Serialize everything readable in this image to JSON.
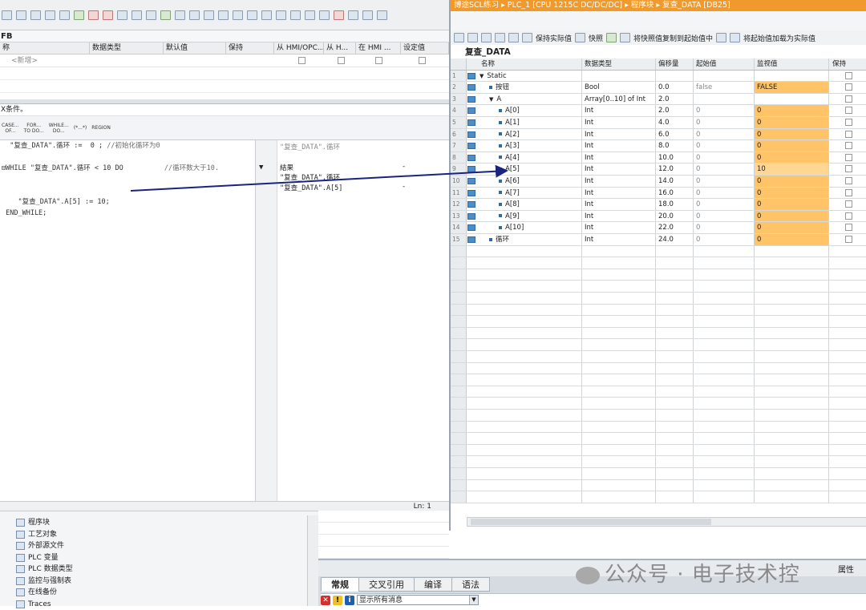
{
  "editor": {
    "block_label": "FB",
    "interface_headers": [
      "称",
      "数据类型",
      "默认值",
      "保持",
      "从 HMI/OPC...",
      "从 H...",
      "在 HMI ...",
      "设定值"
    ],
    "interface_new_row": "<新增>",
    "condition_label": "X条件。",
    "instructions": [
      {
        "line1": "CASE...",
        "line2": "OF..."
      },
      {
        "line1": "FOR...",
        "line2": "TO DO..."
      },
      {
        "line1": "WHILE...",
        "line2": "DO..."
      },
      {
        "line1": "(*...*)",
        "line2": ""
      },
      {
        "line1": "REGION",
        "line2": ""
      }
    ],
    "code_lines": [
      {
        "code": "  \"复查_DATA\".循环 :=  0 ;",
        "comment": " //初始化循环为0"
      },
      {
        "code": "",
        "comment": ""
      },
      {
        "code": "⊟WHILE \"复查_DATA\".循环 < 10 DO",
        "comment": "          //循环数大于10."
      },
      {
        "code": "",
        "comment": ""
      },
      {
        "code": "",
        "comment": ""
      },
      {
        "code": "    \"复查_DATA\".A[5] := 10;",
        "comment": ""
      },
      {
        "code": " END_WHILE;",
        "comment": ""
      }
    ],
    "watch": {
      "line1": "\"复查_DATA\".循环",
      "result_label": "結果",
      "line3": "\"复查_DATA\".循环",
      "line4": "\"复查_DATA\".A[5]",
      "dash": "-"
    },
    "status": "Ln: 1"
  },
  "project_tree": {
    "items": [
      {
        "label": "程序块",
        "icon": "program-block-icon"
      },
      {
        "label": "工艺对象",
        "icon": "technology-object-icon"
      },
      {
        "label": "外部源文件",
        "icon": "external-source-icon"
      },
      {
        "label": "PLC 变量",
        "icon": "plc-tags-icon"
      },
      {
        "label": "PLC 数据类型",
        "icon": "plc-data-type-icon"
      },
      {
        "label": "监控与强制表",
        "icon": "watch-table-icon"
      },
      {
        "label": "在线备份",
        "icon": "online-backup-icon"
      },
      {
        "label": "Traces",
        "icon": "traces-icon"
      }
    ]
  },
  "inspector": {
    "tabs": [
      "常规",
      "交叉引用",
      "编译",
      "语法"
    ],
    "message_filter": "显示所有消息",
    "properties_label": "属性"
  },
  "watermark": "公众号 · 电子技术控",
  "db_window": {
    "breadcrumb": "博途SCL练习 ▸ PLC_1 [CPU 1215C DC/DC/DC] ▸ 程序块 ▸ 复查_DATA [DB25]",
    "toolbar": {
      "keep_actual": "保持实际值",
      "snapshot": "快照",
      "copy_snapshot": "将快照值复制到起始值中",
      "load_start": "将起始值加载为实际值"
    },
    "db_name": "复查_DATA",
    "columns": {
      "name": "名称",
      "datatype": "数据类型",
      "offset": "偏移量",
      "start": "起始值",
      "monitor": "监视值",
      "retain": "保持"
    },
    "rows": [
      {
        "n": "1",
        "name": "Static",
        "type": "",
        "offset": "",
        "start": "",
        "monitor": "",
        "level": 0,
        "expand": "▼",
        "hl": ""
      },
      {
        "n": "2",
        "name": "按钮",
        "type": "Bool",
        "offset": "0.0",
        "start": "false",
        "monitor": "FALSE",
        "level": 1,
        "expand": "",
        "hl": "or"
      },
      {
        "n": "3",
        "name": "A",
        "type": "Array[0..10] of Int",
        "offset": "2.0",
        "start": "",
        "monitor": "",
        "level": 1,
        "expand": "▼",
        "hl": ""
      },
      {
        "n": "4",
        "name": "A[0]",
        "type": "Int",
        "offset": "2.0",
        "start": "0",
        "monitor": "0",
        "level": 2,
        "expand": "",
        "hl": "or"
      },
      {
        "n": "5",
        "name": "A[1]",
        "type": "Int",
        "offset": "4.0",
        "start": "0",
        "monitor": "0",
        "level": 2,
        "expand": "",
        "hl": "or"
      },
      {
        "n": "6",
        "name": "A[2]",
        "type": "Int",
        "offset": "6.0",
        "start": "0",
        "monitor": "0",
        "level": 2,
        "expand": "",
        "hl": "or"
      },
      {
        "n": "7",
        "name": "A[3]",
        "type": "Int",
        "offset": "8.0",
        "start": "0",
        "monitor": "0",
        "level": 2,
        "expand": "",
        "hl": "or"
      },
      {
        "n": "8",
        "name": "A[4]",
        "type": "Int",
        "offset": "10.0",
        "start": "0",
        "monitor": "0",
        "level": 2,
        "expand": "",
        "hl": "or"
      },
      {
        "n": "9",
        "name": "A[5]",
        "type": "Int",
        "offset": "12.0",
        "start": "0",
        "monitor": "10",
        "level": 2,
        "expand": "",
        "hl": "or2"
      },
      {
        "n": "10",
        "name": "A[6]",
        "type": "Int",
        "offset": "14.0",
        "start": "0",
        "monitor": "0",
        "level": 2,
        "expand": "",
        "hl": "or"
      },
      {
        "n": "11",
        "name": "A[7]",
        "type": "Int",
        "offset": "16.0",
        "start": "0",
        "monitor": "0",
        "level": 2,
        "expand": "",
        "hl": "or"
      },
      {
        "n": "12",
        "name": "A[8]",
        "type": "Int",
        "offset": "18.0",
        "start": "0",
        "monitor": "0",
        "level": 2,
        "expand": "",
        "hl": "or"
      },
      {
        "n": "13",
        "name": "A[9]",
        "type": "Int",
        "offset": "20.0",
        "start": "0",
        "monitor": "0",
        "level": 2,
        "expand": "",
        "hl": "or"
      },
      {
        "n": "14",
        "name": "A[10]",
        "type": "Int",
        "offset": "22.0",
        "start": "0",
        "monitor": "0",
        "level": 2,
        "expand": "",
        "hl": "or"
      },
      {
        "n": "15",
        "name": "循环",
        "type": "Int",
        "offset": "24.0",
        "start": "0",
        "monitor": "0",
        "level": 1,
        "expand": "",
        "hl": "or"
      }
    ]
  },
  "colors": {
    "title_bar": "#f09a2e",
    "monitor_highlight": "#ffc468",
    "arrow": "#1a237e"
  }
}
